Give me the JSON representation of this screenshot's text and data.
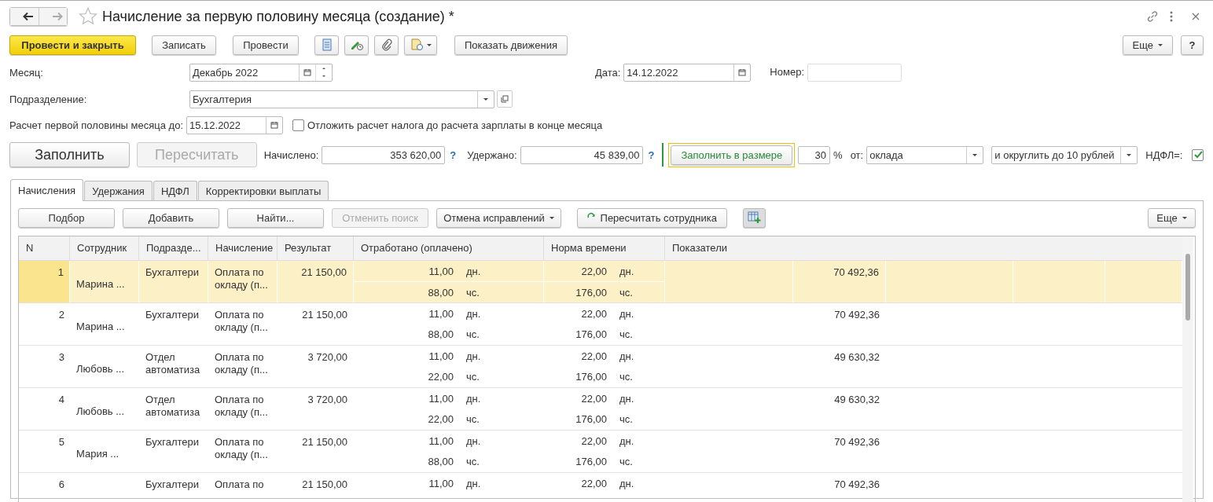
{
  "window": {
    "title": "Начисление за первую половину месяца (создание) *"
  },
  "toolbar": {
    "post_close": "Провести и закрыть",
    "write": "Записать",
    "post": "Провести",
    "movements": "Показать движения",
    "more": "Еще",
    "help": "?"
  },
  "month": {
    "label": "Месяц:",
    "value": "Декабрь 2022"
  },
  "date": {
    "label": "Дата:",
    "value": "14.12.2022"
  },
  "number": {
    "label": "Номер:"
  },
  "department": {
    "label": "Подразделение:",
    "value": "Бухгалтерия"
  },
  "first_half_until": {
    "label": "Расчет первой половины месяца до:",
    "value": "15.12.2022"
  },
  "defer_tax": {
    "label": "Отложить расчет налога до расчета зарплаты в конце месяца",
    "checked": false
  },
  "fill": {
    "label": "Заполнить"
  },
  "recalculate": {
    "label": "Пересчитать",
    "disabled": true
  },
  "accrued": {
    "label": "Начислено:",
    "value": "353 620,00",
    "hint": "?"
  },
  "withheld": {
    "label": "Удержано:",
    "value": "45 839,00",
    "hint": "?"
  },
  "fill_size": {
    "label": "Заполнить в размере"
  },
  "percent": {
    "value": "30",
    "unit": "%"
  },
  "base": {
    "label": "от:",
    "value": "оклада"
  },
  "rounding": {
    "value": "и округлить до 10 рублей"
  },
  "ndfl": {
    "label": "НДФЛ=:",
    "checked": true
  },
  "tabs": [
    {
      "label": "Начисления",
      "selected": true
    },
    {
      "label": "Удержания",
      "selected": false
    },
    {
      "label": "НДФЛ",
      "selected": false
    },
    {
      "label": "Корректировки выплаты",
      "selected": false
    }
  ],
  "table_toolbar": {
    "buttons": [
      {
        "kind": "button",
        "label": "Подбор",
        "disabled": false
      },
      {
        "kind": "button",
        "label": "Добавить",
        "disabled": false
      },
      {
        "kind": "button",
        "label": "Найти...",
        "disabled": false
      },
      {
        "kind": "button",
        "label": "Отменить поиск",
        "disabled": true
      },
      {
        "kind": "menu",
        "label": "Отмена исправлений",
        "disabled": false
      },
      {
        "kind": "refresh",
        "label": "Пересчитать сотрудника",
        "disabled": false
      }
    ],
    "more": "Еще"
  },
  "table": {
    "columns": [
      "N",
      "Сотрудник",
      "Подразде...",
      "Начисление",
      "Результат",
      "Отработано (оплачено)",
      "Норма времени",
      "Показатели"
    ],
    "rows": [
      {
        "n": "1",
        "employee": "Марина ...",
        "department": "Бухгалтери",
        "accrual": "Оплата по\nокладу (п...",
        "result": "21 150,00",
        "worked": [
          {
            "value": "11,00",
            "unit": "дн."
          },
          {
            "value": "88,00",
            "unit": "чс."
          }
        ],
        "norm": [
          {
            "value": "22,00",
            "unit": "дн."
          },
          {
            "value": "176,00",
            "unit": "чс."
          }
        ],
        "indicator": "70 492,36",
        "selected": true
      },
      {
        "n": "2",
        "employee": "Марина ...",
        "department": "Бухгалтери",
        "accrual": "Оплата по\nокладу (п...",
        "result": "21 150,00",
        "worked": [
          {
            "value": "11,00",
            "unit": "дн."
          },
          {
            "value": "88,00",
            "unit": "чс."
          }
        ],
        "norm": [
          {
            "value": "22,00",
            "unit": "дн."
          },
          {
            "value": "176,00",
            "unit": "чс."
          }
        ],
        "indicator": "70 492,36",
        "selected": false
      },
      {
        "n": "3",
        "employee": "Любовь ...",
        "department": "Отдел\nавтоматиза",
        "accrual": "Оплата по\nокладу (п...",
        "result": "3 720,00",
        "worked": [
          {
            "value": "11,00",
            "unit": "дн."
          },
          {
            "value": "22,00",
            "unit": "чс."
          }
        ],
        "norm": [
          {
            "value": "22,00",
            "unit": "дн."
          },
          {
            "value": "176,00",
            "unit": "чс."
          }
        ],
        "indicator": "49 630,32",
        "selected": false
      },
      {
        "n": "4",
        "employee": "Любовь ...",
        "department": "Отдел\nавтоматиза",
        "accrual": "Оплата по\nокладу (п...",
        "result": "3 720,00",
        "worked": [
          {
            "value": "11,00",
            "unit": "дн."
          },
          {
            "value": "22,00",
            "unit": "чс."
          }
        ],
        "norm": [
          {
            "value": "22,00",
            "unit": "дн."
          },
          {
            "value": "176,00",
            "unit": "чс."
          }
        ],
        "indicator": "49 630,32",
        "selected": false
      },
      {
        "n": "5",
        "employee": "Мария ...",
        "department": "Бухгалтери",
        "accrual": "Оплата по\nокладу (п...",
        "result": "21 150,00",
        "worked": [
          {
            "value": "11,00",
            "unit": "дн."
          },
          {
            "value": "88,00",
            "unit": "чс."
          }
        ],
        "norm": [
          {
            "value": "22,00",
            "unit": "дн."
          },
          {
            "value": "176,00",
            "unit": "чс."
          }
        ],
        "indicator": "70 492,36",
        "selected": false
      },
      {
        "n": "6",
        "department": "Бухгалтери",
        "accrual": "Оплата по",
        "result": "21 150,00",
        "worked": [
          {
            "value": "11,00",
            "unit": "дн."
          }
        ],
        "norm": [
          {
            "value": "22,00",
            "unit": "дн."
          }
        ],
        "indicator": "70 492,36",
        "selected": false
      }
    ]
  }
}
